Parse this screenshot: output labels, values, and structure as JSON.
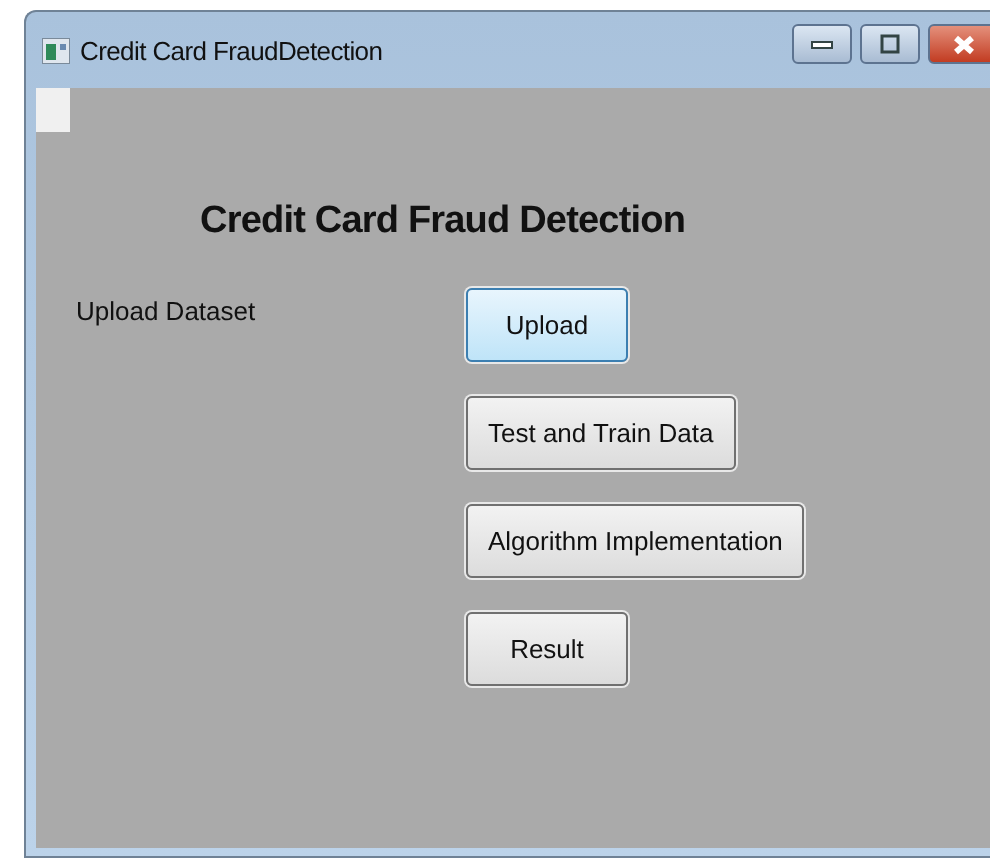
{
  "window": {
    "title": "Credit Card FraudDetection"
  },
  "heading": "Credit Card Fraud Detection",
  "label": "Upload Dataset",
  "buttons": [
    {
      "label": "Upload",
      "selected": true
    },
    {
      "label": "Test and Train Data",
      "selected": false
    },
    {
      "label": "Algorithm Implementation",
      "selected": false
    },
    {
      "label": "Result",
      "selected": false
    }
  ]
}
